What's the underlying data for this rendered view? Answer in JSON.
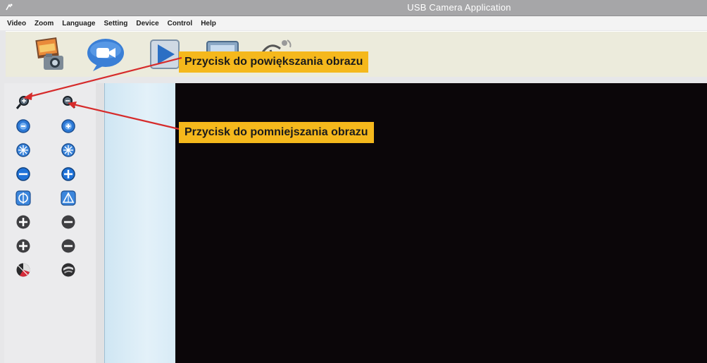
{
  "window": {
    "title": "USB Camera Application"
  },
  "menu": [
    "Video",
    "Zoom",
    "Language",
    "Setting",
    "Device",
    "Control",
    "Help"
  ],
  "toolbar": {
    "buttons": [
      {
        "name": "snapshot-button",
        "icon": "photo-camera-icon"
      },
      {
        "name": "record-video-button",
        "icon": "video-camera-icon"
      },
      {
        "name": "play-button",
        "icon": "play-icon"
      },
      {
        "name": "preview-button",
        "icon": "monitor-icon"
      },
      {
        "name": "satellite-button",
        "icon": "satellite-dish-icon"
      }
    ]
  },
  "controls": [
    {
      "name": "zoom-in-button",
      "icon": "magnifier-plus-icon"
    },
    {
      "name": "zoom-out-button",
      "icon": "magnifier-minus-icon"
    },
    {
      "name": "blue-minus-button",
      "icon": "blue-minus-icon"
    },
    {
      "name": "blue-plus-button",
      "icon": "blue-plus-icon"
    },
    {
      "name": "focus-near-button",
      "icon": "snowflake-icon"
    },
    {
      "name": "focus-far-button",
      "icon": "snowflake-icon"
    },
    {
      "name": "decrease-button",
      "icon": "blue-circle-minus-icon"
    },
    {
      "name": "increase-button",
      "icon": "blue-circle-plus-icon"
    },
    {
      "name": "iris-button",
      "icon": "circle-target-icon"
    },
    {
      "name": "tilt-button",
      "icon": "triangle-icon"
    },
    {
      "name": "gray-plus-button",
      "icon": "gray-plus-icon"
    },
    {
      "name": "gray-minus-button",
      "icon": "gray-minus-icon"
    },
    {
      "name": "gray-plus-button-2",
      "icon": "gray-plus-icon"
    },
    {
      "name": "gray-minus-button-2",
      "icon": "gray-minus-icon"
    },
    {
      "name": "color-wheel-button",
      "icon": "color-wheel-icon"
    },
    {
      "name": "dark-orb-button",
      "icon": "dark-orb-icon"
    }
  ],
  "callouts": {
    "zoom_in": "Przycisk do powiększania obrazu",
    "zoom_out": "Przycisk do pomniejszania obrazu"
  },
  "colors": {
    "callout": "#f5b81c",
    "arrow": "#d62b2b",
    "video_bg": "#0b0609"
  }
}
